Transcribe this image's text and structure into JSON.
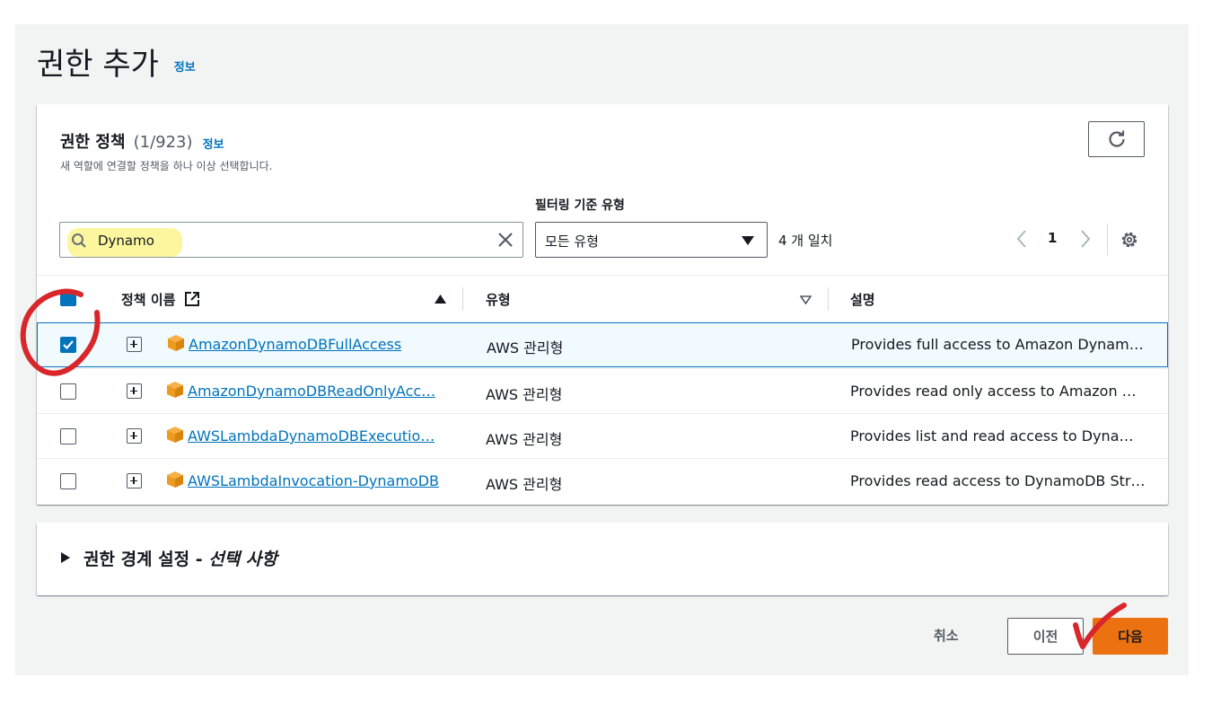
{
  "page": {
    "title": "권한 추가",
    "info_label": "정보"
  },
  "policies_panel": {
    "title": "권한 정책",
    "count": "(1/923)",
    "info_label": "정보",
    "description": "새 역할에 연결할 정책을 하나 이상 선택합니다."
  },
  "filter": {
    "search_value": "Dynamo",
    "type_label": "필터링 기준 유형",
    "type_selected": "모든 유형",
    "match_count": "4 개 일치"
  },
  "pagination": {
    "current_page": "1"
  },
  "table": {
    "columns": [
      "정책 이름",
      "유형",
      "설명"
    ],
    "rows": [
      {
        "name": "AmazonDynamoDBFullAccess",
        "type": "AWS 관리형",
        "description": "Provides full access to Amazon Dynam…",
        "checked": true
      },
      {
        "name": "AmazonDynamoDBReadOnlyAcc…",
        "type": "AWS 관리형",
        "description": "Provides read only access to Amazon D…",
        "checked": false
      },
      {
        "name": "AWSLambdaDynamoDBExecutio…",
        "type": "AWS 관리형",
        "description": "Provides list and read access to Dynam…",
        "checked": false
      },
      {
        "name": "AWSLambdaInvocation-DynamoDB",
        "type": "AWS 관리형",
        "description": "Provides read access to DynamoDB Str…",
        "checked": false
      }
    ]
  },
  "boundary": {
    "title": "권한 경계 설정 - ",
    "optional": "선택 사항"
  },
  "footer": {
    "cancel_label": "취소",
    "prev_label": "이전",
    "next_label": "다음"
  },
  "colors": {
    "link": "#0073bb",
    "primary_button": "#ec7211",
    "annotation_red": "#d9262b",
    "highlight_yellow": "#fcf79a"
  }
}
